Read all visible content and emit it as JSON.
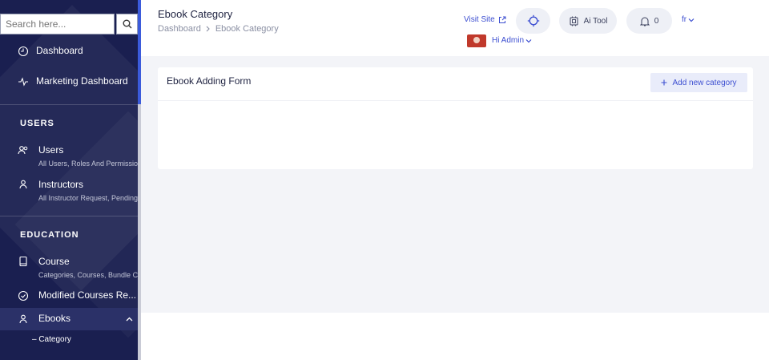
{
  "sidebar": {
    "search_placeholder": "Search here...",
    "items": [
      {
        "label": "Dashboard"
      },
      {
        "label": "Marketing Dashboard"
      }
    ],
    "sections": [
      {
        "title": "USERS",
        "items": [
          {
            "label": "Users",
            "sub": "All Users, Roles And Permission"
          },
          {
            "label": "Instructors",
            "sub": "All Instructor Request, Pending..."
          }
        ]
      },
      {
        "title": "EDUCATION",
        "items": [
          {
            "label": "Course",
            "sub": "Categories, Courses, Bundle Co..."
          },
          {
            "label": "Modified Courses Re..."
          },
          {
            "label": "Ebooks"
          }
        ],
        "subitem": "– Category"
      }
    ]
  },
  "header": {
    "title": "Ebook Category",
    "breadcrumb": [
      "Dashboard",
      "Ebook Category"
    ],
    "visit_site": "Visit Site",
    "ai_tool": "Ai Tool",
    "notifications_count": "0",
    "language": "fr",
    "greeting": "Hi Admin"
  },
  "card": {
    "title": "Ebook Adding Form",
    "add_button": "Add new category"
  },
  "colors": {
    "sidebar": "#1a1f50",
    "accent": "#3d4fd1",
    "content_bg": "#f3f4f8"
  }
}
